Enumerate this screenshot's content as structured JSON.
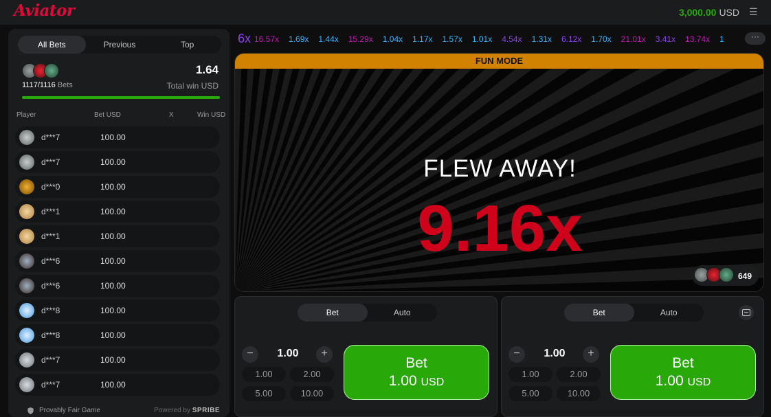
{
  "header": {
    "logo": "Aviator",
    "balance": "3,000.00",
    "currency": "USD"
  },
  "left_panel": {
    "tabs": [
      "All Bets",
      "Previous",
      "Top"
    ],
    "active_tab": "All Bets",
    "bets_count": "1117/1116",
    "bets_label": "Bets",
    "total_win": "1.64",
    "total_win_label": "Total win USD",
    "progress_fraction": 1.0,
    "columns": {
      "player": "Player",
      "bet": "Bet USD",
      "x": "X",
      "win": "Win USD"
    },
    "rows": [
      {
        "player": "d***7",
        "bet": "100.00",
        "avatar": "plane-avatar"
      },
      {
        "player": "d***7",
        "bet": "100.00",
        "avatar": "plane-avatar"
      },
      {
        "player": "d***0",
        "bet": "100.00",
        "avatar": "gold-avatar"
      },
      {
        "player": "d***1",
        "bet": "100.00",
        "avatar": "face-avatar"
      },
      {
        "player": "d***1",
        "bet": "100.00",
        "avatar": "face-avatar"
      },
      {
        "player": "d***6",
        "bet": "100.00",
        "avatar": "jet-avatar"
      },
      {
        "player": "d***6",
        "bet": "100.00",
        "avatar": "jet-avatar"
      },
      {
        "player": "d***8",
        "bet": "100.00",
        "avatar": "blue-plane-avatar"
      },
      {
        "player": "d***8",
        "bet": "100.00",
        "avatar": "blue-plane-avatar"
      },
      {
        "player": "d***7",
        "bet": "100.00",
        "avatar": "grey-jet-avatar"
      },
      {
        "player": "d***7",
        "bet": "100.00",
        "avatar": "grey-jet-avatar"
      }
    ],
    "footer": {
      "provably_fair": "Provably Fair Game",
      "powered_by": "Powered by",
      "brand": "SPRIBE"
    }
  },
  "history": {
    "first": "6x",
    "items": [
      {
        "value": "16.57x",
        "color": "#c017b4"
      },
      {
        "value": "1.69x",
        "color": "#34b4ff"
      },
      {
        "value": "1.44x",
        "color": "#34b4ff"
      },
      {
        "value": "15.29x",
        "color": "#c017b4"
      },
      {
        "value": "1.04x",
        "color": "#34b4ff"
      },
      {
        "value": "1.17x",
        "color": "#34b4ff"
      },
      {
        "value": "1.57x",
        "color": "#34b4ff"
      },
      {
        "value": "1.01x",
        "color": "#34b4ff"
      },
      {
        "value": "4.54x",
        "color": "#913ef8"
      },
      {
        "value": "1.31x",
        "color": "#34b4ff"
      },
      {
        "value": "6.12x",
        "color": "#913ef8"
      },
      {
        "value": "1.70x",
        "color": "#34b4ff"
      },
      {
        "value": "21.01x",
        "color": "#c017b4"
      },
      {
        "value": "3.41x",
        "color": "#913ef8"
      },
      {
        "value": "13.74x",
        "color": "#c017b4"
      },
      {
        "value": "1",
        "color": "#34b4ff"
      }
    ],
    "more": "···"
  },
  "game": {
    "fun_mode": "FUN MODE",
    "flew_away": "FLEW AWAY!",
    "multiplier": "9.16x",
    "online_count": "649"
  },
  "bet_panels": [
    {
      "tabs": [
        "Bet",
        "Auto"
      ],
      "active_tab": "Bet",
      "amount": "1.00",
      "quick": [
        "1.00",
        "2.00",
        "5.00",
        "10.00"
      ],
      "button_label": "Bet",
      "button_amount": "1.00",
      "button_currency": "USD"
    },
    {
      "tabs": [
        "Bet",
        "Auto"
      ],
      "active_tab": "Bet",
      "amount": "1.00",
      "quick": [
        "1.00",
        "2.00",
        "5.00",
        "10.00"
      ],
      "button_label": "Bet",
      "button_amount": "1.00",
      "button_currency": "USD"
    }
  ],
  "colors": {
    "brand": "#e50539",
    "win_green": "#28a909",
    "multiplier_red": "#d0021b",
    "fun_mode_bar": "#d08200"
  }
}
